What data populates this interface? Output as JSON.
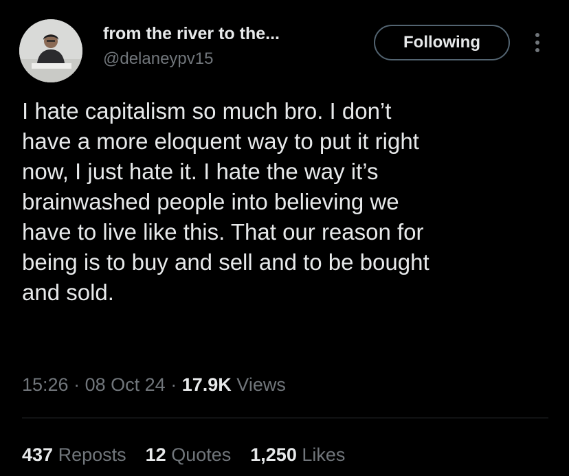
{
  "tweet": {
    "author": {
      "display_name": "from the river to the...",
      "handle": "@delaneypv15",
      "avatar_icon": "user-avatar"
    },
    "follow_button_label": "Following",
    "more_icon": "vertical-ellipsis-icon",
    "text": "I hate capitalism so much bro. I don’t\nhave a more eloquent way to put it right\nnow, I just hate it. I hate the way it’s\nbrainwashed people into believing we\nhave to live like this. That our reason for\nbeing is to buy and sell and to be bought\nand sold.",
    "meta": {
      "time": "15:26",
      "separator": "·",
      "date": "08 Oct 24",
      "views_count": "17.9K",
      "views_label": "Views"
    },
    "stats": {
      "reposts_count": "437",
      "reposts_label": "Reposts",
      "quotes_count": "12",
      "quotes_label": "Quotes",
      "likes_count": "1,250",
      "likes_label": "Likes"
    },
    "colors": {
      "background": "#000000",
      "primary_text": "#e7e9ea",
      "secondary_text": "#71767b",
      "button_border": "#536471",
      "divider": "#2f3336"
    }
  }
}
